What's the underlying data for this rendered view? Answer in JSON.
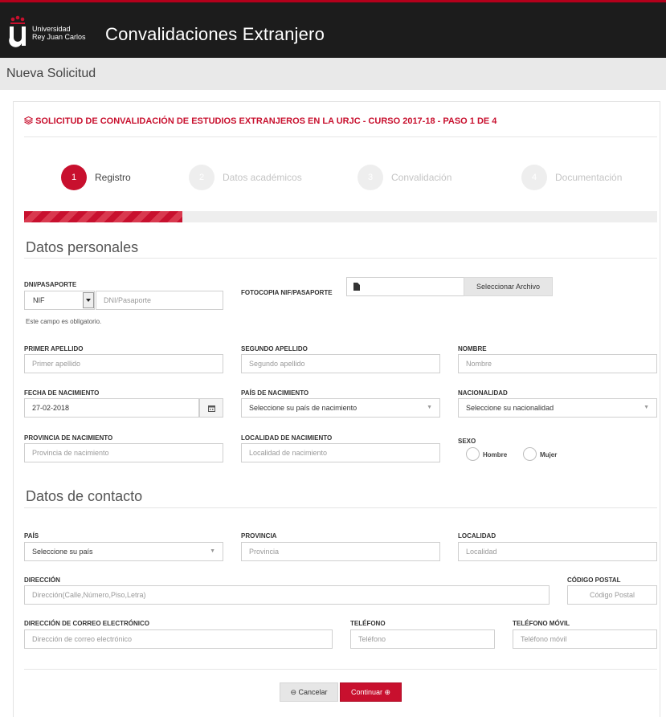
{
  "header": {
    "logo_text_line1": "Universidad",
    "logo_text_line2": "Rey Juan Carlos",
    "app_title": "Convalidaciones Extranjero",
    "accent_color": "#c8102e",
    "bar_color": "#1c1c1c"
  },
  "subheader": {
    "title": "Nueva Solicitud"
  },
  "form": {
    "heading": "SOLICITUD DE CONVALIDACIÓN DE ESTUDIOS EXTRANJEROS EN LA URJC - CURSO 2017-18 - PASO 1 DE 4",
    "heading_icon": "stack-icon",
    "progress_fraction": 0.25
  },
  "steps": [
    {
      "number": "1",
      "label": "Registro",
      "active": true
    },
    {
      "number": "2",
      "label": "Datos académicos",
      "active": false
    },
    {
      "number": "3",
      "label": "Convalidación",
      "active": false
    },
    {
      "number": "4",
      "label": "Documentación",
      "active": false
    }
  ],
  "personal": {
    "section_title": "Datos personales",
    "dni_label": "DNI/PASAPORTE",
    "doc_type_value": "NIF",
    "dni_placeholder": "DNI/Pasaporte",
    "dni_help": "Este campo es obligatorio.",
    "fotocopia_label": "FOTOCOPIA NIF/PASAPORTE",
    "file_button": "Seleccionar Archivo",
    "primer_apellido_label": "PRIMER APELLIDO",
    "primer_apellido_placeholder": "Primer apellido",
    "segundo_apellido_label": "SEGUNDO APELLIDO",
    "segundo_apellido_placeholder": "Segundo apellido",
    "nombre_label": "NOMBRE",
    "nombre_placeholder": "Nombre",
    "fecha_label": "FECHA DE NACIMIENTO",
    "fecha_value": "27-02-2018",
    "pais_nac_label": "PAÍS DE NACIMIENTO",
    "pais_nac_value": "Seleccione su país de nacimiento",
    "nacionalidad_label": "NACIONALIDAD",
    "nacionalidad_value": "Seleccione su nacionalidad",
    "provincia_nac_label": "PROVINCIA DE NACIMIENTO",
    "provincia_nac_placeholder": "Provincia de nacimiento",
    "localidad_nac_label": "LOCALIDAD DE NACIMIENTO",
    "localidad_nac_placeholder": "Localidad de nacimiento",
    "sexo_label": "SEXO",
    "sexo_hombre": "Hombre",
    "sexo_mujer": "Mujer"
  },
  "contact": {
    "section_title": "Datos de contacto",
    "pais_label": "PAÍS",
    "pais_value": "Seleccione su país",
    "provincia_label": "PROVINCIA",
    "provincia_placeholder": "Provincia",
    "localidad_label": "LOCALIDAD",
    "localidad_placeholder": "Localidad",
    "direccion_label": "DIRECCIÓN",
    "direccion_placeholder": "Dirección(Calle,Número,Piso,Letra)",
    "cp_label": "CÓDIGO POSTAL",
    "cp_placeholder": "Código Postal",
    "email_label": "DIRECCIÓN DE CORREO ELECTRÓNICO",
    "email_placeholder": "Dirección de correo electrónico",
    "telefono_label": "TELÉFONO",
    "telefono_placeholder": "Teléfono",
    "movil_label": "TELÉFONO MÓVIL",
    "movil_placeholder": "Teléfono móvil"
  },
  "actions": {
    "cancel_label": "Cancelar",
    "continue_label": "Continuar"
  }
}
